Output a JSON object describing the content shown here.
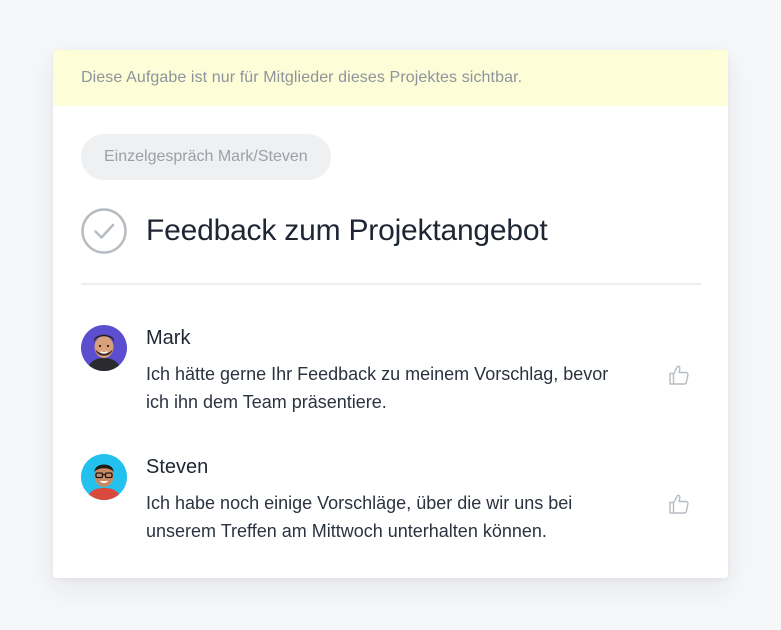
{
  "notice": {
    "text": "Diese Aufgabe ist nur für Mitglieder dieses Projektes sichtbar."
  },
  "task": {
    "tag": "Einzelgespräch Mark/Steven",
    "title": "Feedback zum Projektangebot"
  },
  "comments": [
    {
      "author": "Mark",
      "text": "Ich hätte gerne Ihr Feedback zu meinem Vorschlag, bevor ich ihn dem Team präsentiere.",
      "avatar_bg": "#5b4fcf",
      "like_icon": "thumbs-up-icon"
    },
    {
      "author": "Steven",
      "text": "Ich habe noch einige Vorschläge, über die wir uns bei unserem Treffen am Mittwoch unterhalten können.",
      "avatar_bg": "#22c1ee",
      "like_icon": "thumbs-up-icon"
    }
  ],
  "colors": {
    "notice_bg": "#fdfdd8",
    "tag_bg": "#eef0f2",
    "check_circle": "#b7bcc2"
  }
}
